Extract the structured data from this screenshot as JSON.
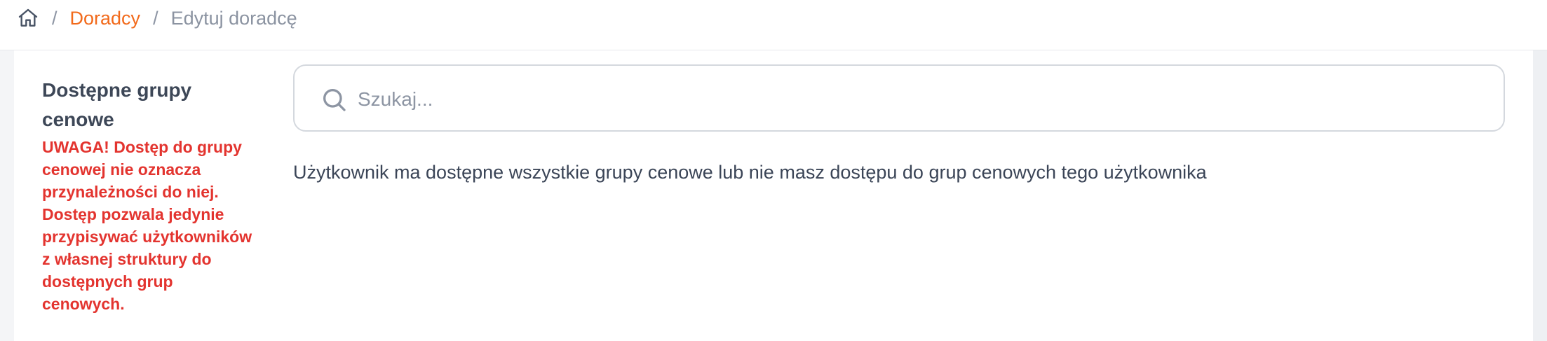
{
  "breadcrumb": {
    "home_icon": "home-icon",
    "separator": "/",
    "items": [
      {
        "label": "Doradcy"
      },
      {
        "label": "Edytuj doradcę"
      }
    ]
  },
  "left_panel": {
    "title": "Dostępne grupy cenowe",
    "warning": "UWAGA! Dostęp do grupy cenowej nie oznacza przynależności do niej. Dostęp pozwala jedynie przypisywać użytkowników z własnej struktury do dostępnych grup cenowych."
  },
  "search": {
    "placeholder": "Szukaj...",
    "value": "",
    "icon": "search-icon"
  },
  "main": {
    "info_text": "Użytkownik ma dostępne wszystkie grupy cenowe lub nie masz dostępu do grup cenowych tego użytkownika"
  },
  "colors": {
    "accent": "#f26a1b",
    "warning": "#e3342f",
    "text": "#3b4557",
    "muted": "#8b93a1"
  }
}
